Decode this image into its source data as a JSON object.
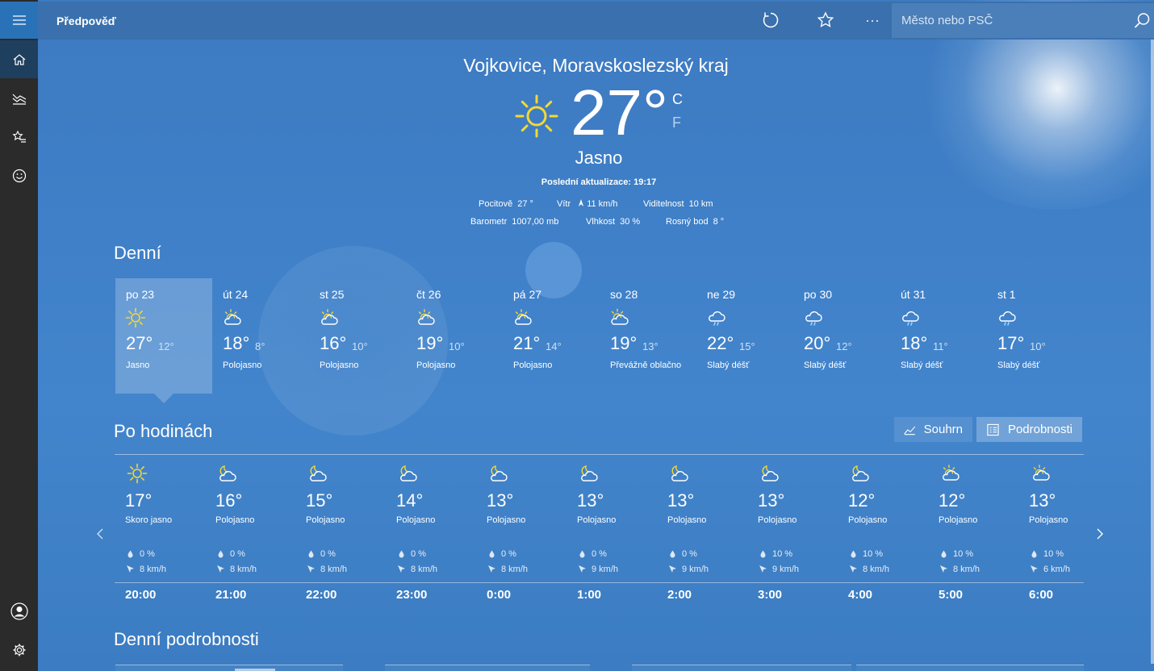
{
  "app": {
    "title": "Předpověď"
  },
  "search": {
    "placeholder": "Město nebo PSČ"
  },
  "current": {
    "location": "Vojkovice, Moravskoslezský kraj",
    "temp": "27°",
    "unit_c": "C",
    "unit_f": "F",
    "condition": "Jasno",
    "updated": "Poslední aktualizace: 19:17",
    "feels_label": "Pocitově",
    "feels_value": "27 °",
    "wind_label": "Vítr",
    "wind_value": "11 km/h",
    "visibility_label": "Viditelnost",
    "visibility_value": "10 km",
    "barometer_label": "Barometr",
    "barometer_value": "1007,00 mb",
    "humidity_label": "Vlhkost",
    "humidity_value": "30 %",
    "dewpoint_label": "Rosný bod",
    "dewpoint_value": "8 °",
    "icon": "sun-icon"
  },
  "daily": {
    "title": "Denní",
    "days": [
      {
        "name": "po 23",
        "hi": "27°",
        "lo": "12°",
        "cond": "Jasno",
        "icon": "sun-icon",
        "selected": true
      },
      {
        "name": "út 24",
        "hi": "18°",
        "lo": "8°",
        "cond": "Polojasno",
        "icon": "partly-cloudy-icon"
      },
      {
        "name": "st 25",
        "hi": "16°",
        "lo": "10°",
        "cond": "Polojasno",
        "icon": "partly-cloudy-icon"
      },
      {
        "name": "čt 26",
        "hi": "19°",
        "lo": "10°",
        "cond": "Polojasno",
        "icon": "partly-cloudy-icon"
      },
      {
        "name": "pá 27",
        "hi": "21°",
        "lo": "14°",
        "cond": "Polojasno",
        "icon": "partly-cloudy-icon"
      },
      {
        "name": "so 28",
        "hi": "19°",
        "lo": "13°",
        "cond": "Převážně oblačno",
        "icon": "mostly-cloudy-icon"
      },
      {
        "name": "ne 29",
        "hi": "22°",
        "lo": "15°",
        "cond": "Slabý déšť",
        "icon": "light-rain-icon"
      },
      {
        "name": "po 30",
        "hi": "20°",
        "lo": "12°",
        "cond": "Slabý déšť",
        "icon": "light-rain-icon"
      },
      {
        "name": "út 31",
        "hi": "18°",
        "lo": "11°",
        "cond": "Slabý déšť",
        "icon": "light-rain-icon"
      },
      {
        "name": "st 1",
        "hi": "17°",
        "lo": "10°",
        "cond": "Slabý déšť",
        "icon": "light-rain-icon"
      }
    ]
  },
  "hourly": {
    "title": "Po hodinách",
    "summary_label": "Souhrn",
    "details_label": "Podrobnosti",
    "hours": [
      {
        "temp": "17°",
        "cond": "Skoro jasno",
        "precip": "0 %",
        "wind": "8 km/h",
        "time": "20:00",
        "icon": "sun-icon"
      },
      {
        "temp": "16°",
        "cond": "Polojasno",
        "precip": "0 %",
        "wind": "8 km/h",
        "time": "21:00",
        "icon": "partly-cloudy-night-icon"
      },
      {
        "temp": "15°",
        "cond": "Polojasno",
        "precip": "0 %",
        "wind": "8 km/h",
        "time": "22:00",
        "icon": "partly-cloudy-night-icon"
      },
      {
        "temp": "14°",
        "cond": "Polojasno",
        "precip": "0 %",
        "wind": "8 km/h",
        "time": "23:00",
        "icon": "partly-cloudy-night-icon"
      },
      {
        "temp": "13°",
        "cond": "Polojasno",
        "precip": "0 %",
        "wind": "8 km/h",
        "time": "0:00",
        "icon": "partly-cloudy-night-icon"
      },
      {
        "temp": "13°",
        "cond": "Polojasno",
        "precip": "0 %",
        "wind": "9 km/h",
        "time": "1:00",
        "icon": "partly-cloudy-night-icon"
      },
      {
        "temp": "13°",
        "cond": "Polojasno",
        "precip": "0 %",
        "wind": "9 km/h",
        "time": "2:00",
        "icon": "partly-cloudy-night-icon"
      },
      {
        "temp": "13°",
        "cond": "Polojasno",
        "precip": "10 %",
        "wind": "9 km/h",
        "time": "3:00",
        "icon": "partly-cloudy-night-icon"
      },
      {
        "temp": "12°",
        "cond": "Polojasno",
        "precip": "10 %",
        "wind": "8 km/h",
        "time": "4:00",
        "icon": "partly-cloudy-night-icon"
      },
      {
        "temp": "12°",
        "cond": "Polojasno",
        "precip": "10 %",
        "wind": "8 km/h",
        "time": "5:00",
        "icon": "partly-cloudy-icon"
      },
      {
        "temp": "13°",
        "cond": "Polojasno",
        "precip": "10 %",
        "wind": "6 km/h",
        "time": "6:00",
        "icon": "partly-cloudy-icon"
      }
    ]
  },
  "daily_details": {
    "title": "Denní podrobnosti"
  },
  "colors": {
    "sun": "#f5d832",
    "sidebar": "#2b2b2b",
    "accent": "#2a72b8"
  }
}
